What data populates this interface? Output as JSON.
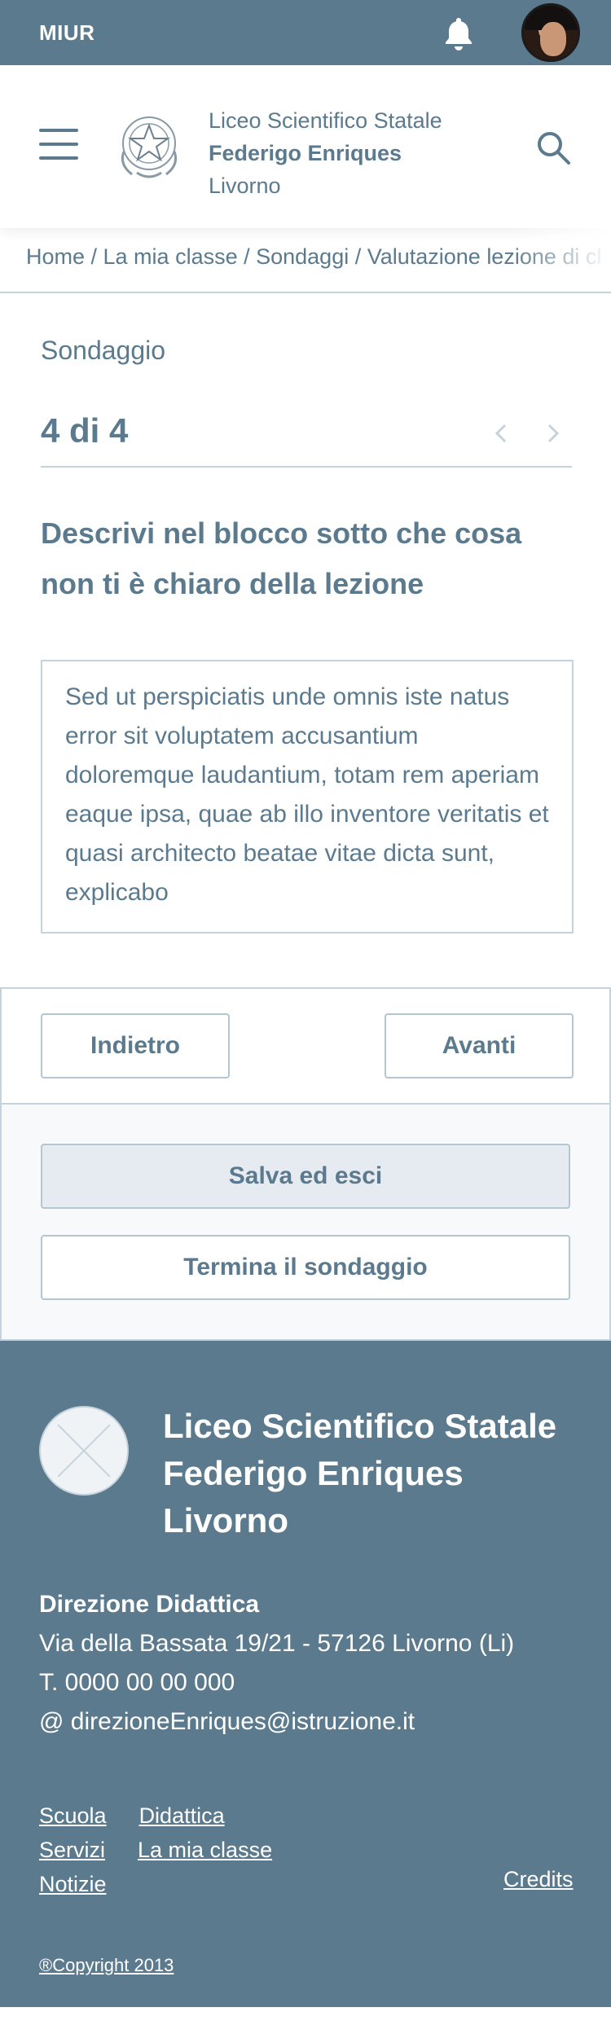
{
  "topbar": {
    "brand": "MIUR",
    "bell_icon": "bell-icon",
    "avatar_icon": "user-avatar"
  },
  "header": {
    "menu_icon": "hamburger-menu-icon",
    "emblem_icon": "italian-republic-emblem",
    "school_line1": "Liceo Scientifico Statale",
    "school_line2": "Federigo Enriques",
    "school_line3": "Livorno",
    "search_icon": "search-icon"
  },
  "breadcrumb": "Home / La mia classe / Sondaggi / Valutazione lezione di cl",
  "survey": {
    "label": "Sondaggio",
    "counter": "4 di 4",
    "question": "Descrivi nel blocco sotto che cosa non ti è chiaro della lezione",
    "answer": "Sed ut perspiciatis unde omnis iste natus error sit voluptatem accusantium doloremque laudantium, totam rem aperiam eaque ipsa, quae ab illo inventore veritatis et quasi architecto beatae vitae dicta sunt, explicabo"
  },
  "buttons": {
    "back": "Indietro",
    "next": "Avanti",
    "save": "Salva ed esci",
    "end": "Termina il sondaggio"
  },
  "footer": {
    "title_line1": "Liceo Scientifico Statale",
    "title_line2": "Federigo Enriques",
    "title_line3": "Livorno",
    "dir_title": "Direzione Didattica",
    "address": "Via della Bassata 19/21 - 57126 Livorno (Li)",
    "phone": "T. 0000 00 00 000",
    "email": "@ direzioneEnriques@istruzione.it",
    "links": {
      "scuola": "Scuola",
      "didattica": "Didattica",
      "servizi": "Servizi",
      "classe": "La mia classe",
      "notizie": "Notizie"
    },
    "credits": "Credits",
    "copyright": "®Copyright 2013"
  },
  "colors": {
    "primary": "#5c7a8d",
    "border": "#c5d3dc",
    "save_bg": "#e6ebf1"
  }
}
